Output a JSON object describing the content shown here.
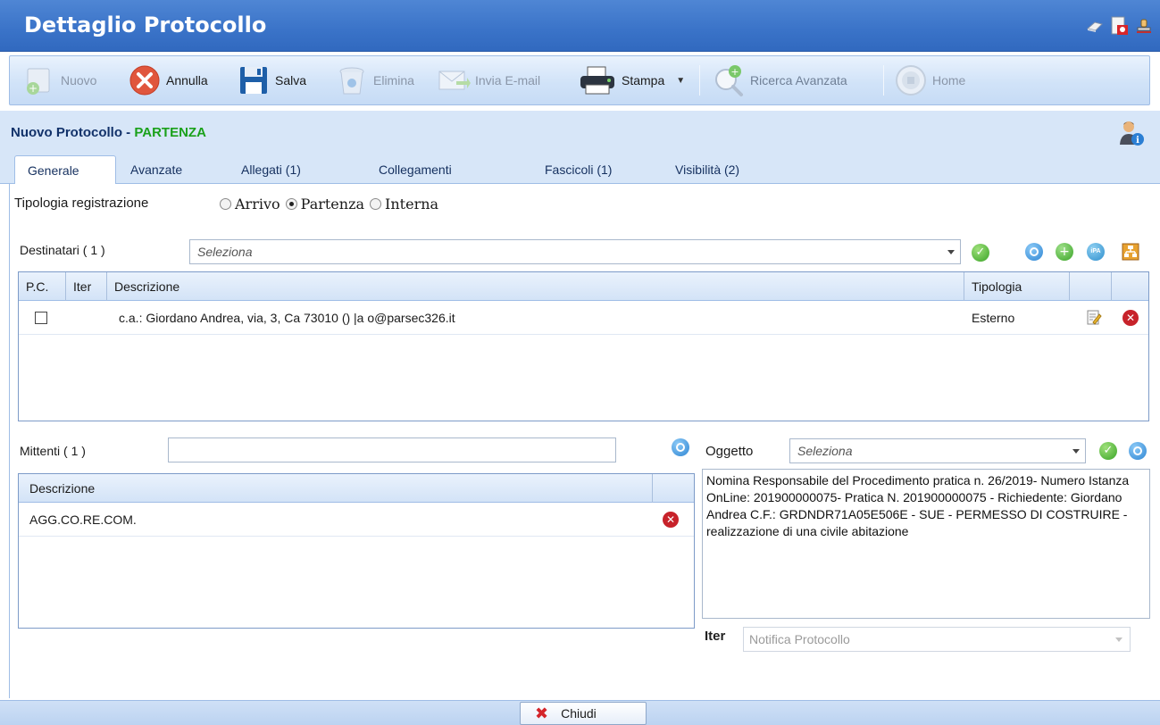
{
  "window": {
    "title": "Dettaglio Protocollo",
    "icons": [
      "eraser-icon",
      "pdf-document-icon",
      "stamp-icon"
    ]
  },
  "toolbar": {
    "nuovo": "Nuovo",
    "annulla": "Annulla",
    "salva": "Salva",
    "elimina": "Elimina",
    "invia_email": "Invia E-mail",
    "stampa": "Stampa",
    "ricerca_avanzata": "Ricerca Avanzata",
    "home": "Home"
  },
  "header": {
    "title": "Nuovo Protocollo",
    "separator": " - ",
    "kind": "PARTENZA",
    "kind_color": "#1aa11a"
  },
  "tabs": [
    {
      "label": "Generale",
      "active": true
    },
    {
      "label": "Avanzate"
    },
    {
      "label": "Allegati (1)"
    },
    {
      "label": "Collegamenti"
    },
    {
      "label": "Fascicoli (1)"
    },
    {
      "label": "Visibilità (2)"
    }
  ],
  "registration": {
    "label": "Tipologia registrazione",
    "options": [
      "Arrivo",
      "Partenza",
      "Interna"
    ],
    "selected": "Partenza"
  },
  "destinatari": {
    "label": "Destinatari ( 1 )",
    "placeholder": "Seleziona",
    "columns": [
      "P.C.",
      "Iter",
      "Descrizione",
      "Tipologia"
    ],
    "rows": [
      {
        "descrizione": "c.a.: Giordano Andrea, via, 3, Ca          73010 () |a           o@parsec326.it",
        "tipologia": "Esterno"
      }
    ]
  },
  "mittenti": {
    "label": "Mittenti ( 1 )",
    "value": "",
    "columns": [
      "Descrizione"
    ],
    "rows": [
      {
        "descrizione": "AGG.CO.RE.COM."
      }
    ]
  },
  "oggetto": {
    "label": "Oggetto",
    "placeholder": "Seleziona",
    "text": "Nomina Responsabile del Procedimento pratica n. 26/2019- Numero Istanza OnLine: 201900000075- Pratica N. 201900000075 - Richiedente: Giordano Andrea C.F.: GRDNDR71A05E506E - SUE - PERMESSO DI COSTRUIRE - realizzazione di una civile abitazione"
  },
  "iter": {
    "label": "Iter",
    "placeholder": "Notifica Protocollo"
  },
  "footer": {
    "close": "Chiudi"
  }
}
